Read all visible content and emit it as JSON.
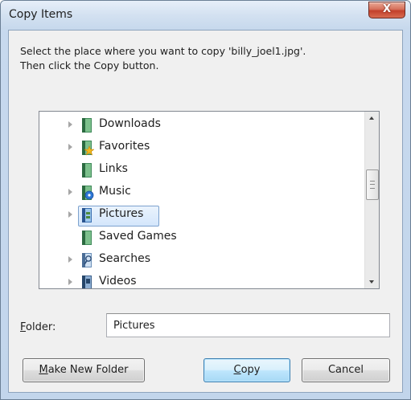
{
  "window": {
    "title": "Copy Items",
    "close_glyph": "X"
  },
  "prompt": {
    "line1": "Select the place where you want to copy 'billy_joel1.jpg'.",
    "line2": "Then click the Copy button."
  },
  "tree": {
    "items": [
      {
        "label": "Downloads",
        "icon": "downloads-folder-icon",
        "expandable": true,
        "selected": false
      },
      {
        "label": "Favorites",
        "icon": "favorites-folder-icon",
        "expandable": true,
        "selected": false
      },
      {
        "label": "Links",
        "icon": "links-folder-icon",
        "expandable": false,
        "selected": false
      },
      {
        "label": "Music",
        "icon": "music-folder-icon",
        "expandable": true,
        "selected": false
      },
      {
        "label": "Pictures",
        "icon": "pictures-folder-icon",
        "expandable": true,
        "selected": true
      },
      {
        "label": "Saved Games",
        "icon": "saved-games-folder-icon",
        "expandable": false,
        "selected": false
      },
      {
        "label": "Searches",
        "icon": "searches-folder-icon",
        "expandable": true,
        "selected": false
      },
      {
        "label": "Videos",
        "icon": "videos-folder-icon",
        "expandable": true,
        "selected": false
      }
    ]
  },
  "folder": {
    "label_mnemonic": "F",
    "label_rest": "older:",
    "value": "Pictures"
  },
  "buttons": {
    "make_new_folder_mnemonic": "M",
    "make_new_folder_rest": "ake New Folder",
    "copy_mnemonic": "C",
    "copy_rest": "opy",
    "cancel": "Cancel"
  },
  "colors": {
    "selection_border": "#7da2ce",
    "default_button_border": "#3c7fb1",
    "close_button": "#c2402b"
  }
}
